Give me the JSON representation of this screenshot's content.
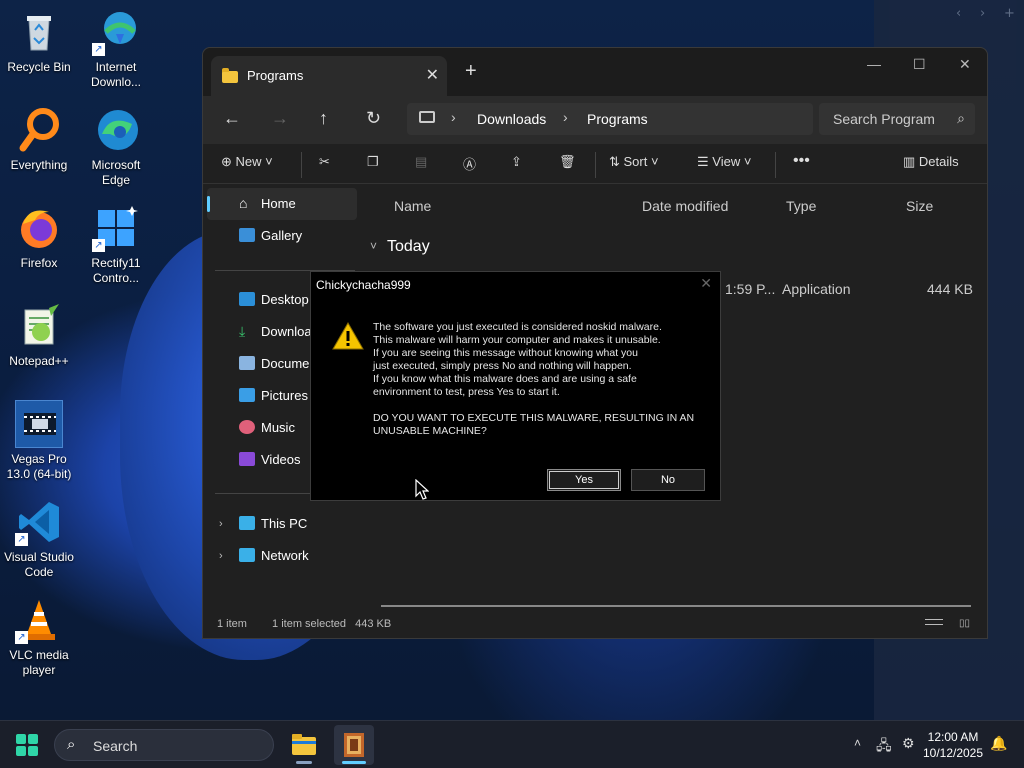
{
  "desktop": {
    "icons": [
      {
        "label": "Recycle Bin"
      },
      {
        "label": "Internet Downlo..."
      },
      {
        "label": "Everything"
      },
      {
        "label": "Microsoft Edge"
      },
      {
        "label": "Firefox"
      },
      {
        "label": "Rectify11 Contro..."
      },
      {
        "label": "Notepad++"
      },
      {
        "label": "Vegas Pro 13.0 (64-bit)"
      },
      {
        "label": "Visual Studio Code"
      },
      {
        "label": "VLC media player"
      }
    ]
  },
  "explorer": {
    "tab_title": "Programs",
    "breadcrumb": [
      "Downloads",
      "Programs"
    ],
    "search_placeholder": "Search Program",
    "commands": {
      "new": "New",
      "sort": "Sort",
      "view": "View",
      "details": "Details"
    },
    "sidebar": {
      "home": "Home",
      "gallery": "Gallery",
      "desktop": "Desktop",
      "downloads": "Downloa",
      "documents": "Documen",
      "pictures": "Pictures",
      "music": "Music",
      "videos": "Videos",
      "this_pc": "This PC",
      "network": "Network"
    },
    "columns": {
      "name": "Name",
      "date": "Date modified",
      "type": "Type",
      "size": "Size"
    },
    "group": "Today",
    "row": {
      "date": "1:59 P...",
      "type": "Application",
      "size": "444 KB"
    },
    "status": {
      "count": "1 item",
      "selected": "1 item selected",
      "size": "443 KB"
    }
  },
  "dialog": {
    "title": "Chickychacha999",
    "lines": [
      "The software you just executed is considered noskid malware.",
      "This malware will harm your computer and makes it unusable.",
      "If you are seeing this message without knowing what you",
      "just executed, simply press No and nothing will happen.",
      "If you know what this malware does and are using a safe",
      "environment to test, press Yes to start it."
    ],
    "question_lines": [
      "DO YOU WANT TO EXECUTE THIS MALWARE, RESULTING IN AN",
      "UNUSABLE MACHINE?"
    ],
    "yes_label": "Yes",
    "no_label": "No"
  },
  "taskbar": {
    "search_label": "Search",
    "time": "12:00 AM",
    "date": "10/12/2025"
  },
  "colors": {
    "accent": "#60cdff",
    "start": "#2fd6a8",
    "folder": "#f4c53d",
    "warning": "#f5c400"
  }
}
